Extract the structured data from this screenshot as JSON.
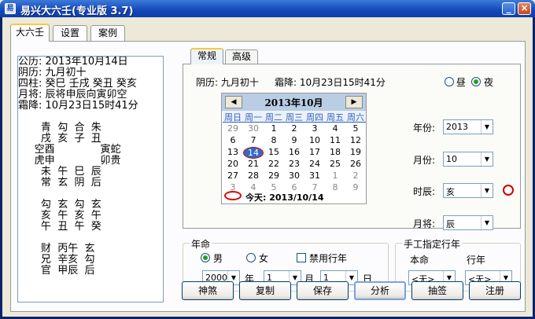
{
  "window": {
    "title": "易兴大六壬(专业版 3.7)",
    "icon": "app-icon"
  },
  "top_tabs": [
    "大六壬",
    "设置",
    "案例"
  ],
  "output_lines": [
    "公历: 2013年10月14日",
    "阴历: 九月初十",
    "四柱: 癸巳 壬戌 癸丑 癸亥",
    "月将: 辰将申辰向寅卯空",
    "霜降: 10月23日15时41分",
    "",
    "       青  勾  合  朱",
    "       戌  亥  子  丑",
    "     空酉              寅蛇",
    "     虎申              卯贵",
    "       未  午  巳  辰",
    "       常  玄  阴  后",
    "",
    "       勾  玄  勾  玄",
    "       亥  午  亥  午",
    "       午  丑  午  癸",
    "",
    "       财  丙午  玄",
    "       兄  辛亥  勾",
    "       官  甲辰  后"
  ],
  "sub_tabs": [
    "常规",
    "高级"
  ],
  "info": {
    "lunar": "阴历: 九月初十",
    "jieqi": "霜降: 10月23日15时41分"
  },
  "daynight": {
    "day": "昼",
    "night": "夜",
    "selected": "night"
  },
  "calendar": {
    "title": "2013年10月",
    "prev": "◀",
    "next": "▶",
    "weekdays": [
      "周日",
      "周一",
      "周二",
      "周三",
      "周四",
      "周五",
      "周六"
    ],
    "weeks": [
      [
        "29",
        "30",
        "1",
        "2",
        "3",
        "4",
        "5"
      ],
      [
        "6",
        "7",
        "8",
        "9",
        "10",
        "11",
        "12"
      ],
      [
        "13",
        "14",
        "15",
        "16",
        "17",
        "18",
        "19"
      ],
      [
        "20",
        "21",
        "22",
        "23",
        "24",
        "25",
        "26"
      ],
      [
        "27",
        "28",
        "29",
        "30",
        "31",
        "1",
        "2"
      ],
      [
        "3",
        "4",
        "5",
        "6",
        "7",
        "8",
        "9"
      ]
    ],
    "today_label": "今天: 2013/10/14",
    "selected_day": "14"
  },
  "fields": {
    "year_label": "年份:",
    "year": "2013",
    "month_label": "月份:",
    "month": "10",
    "hour_label": "时辰:",
    "hour": "亥",
    "jiang_label": "月将:",
    "jiang": "辰"
  },
  "nianming": {
    "title": "年命",
    "male": "男",
    "female": "女",
    "gender": "male",
    "disable_label": "禁用行年",
    "year": "2000",
    "year_unit": "年",
    "month": "1",
    "month_unit": "月",
    "day": "1",
    "day_unit": "日"
  },
  "manual": {
    "title": "手工指定行年",
    "benming_label": "本命",
    "xingnian_label": "行年",
    "benming": "<无>",
    "xingnian": "<无>"
  },
  "buttons": [
    "神煞",
    "复制",
    "保存",
    "分析",
    "抽签",
    "注册"
  ],
  "colors": {
    "title": "#1447b8",
    "accent": "#ffc83c",
    "today_circle": "#dd0000"
  }
}
